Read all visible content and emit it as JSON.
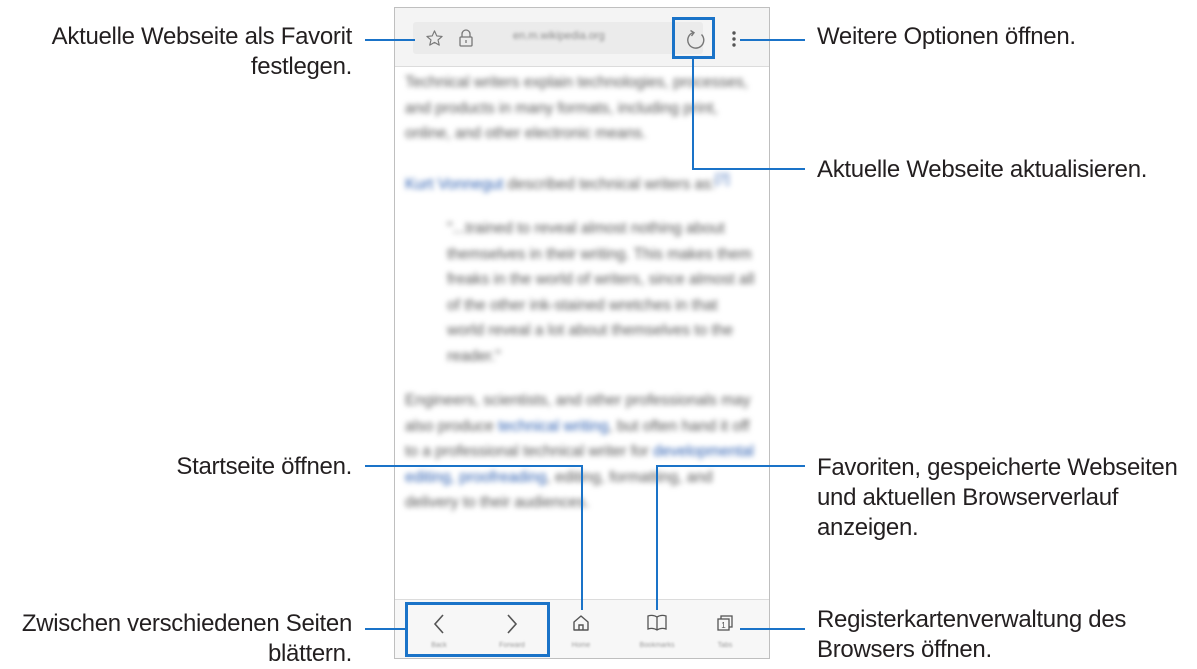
{
  "callouts": {
    "favorite": [
      "Aktuelle Webseite als Favorit",
      "festlegen."
    ],
    "more_options": "Weitere Optionen öffnen.",
    "refresh": "Aktuelle Webseite aktualisieren.",
    "home": "Startseite öffnen.",
    "bookmarks": [
      "Favoriten, gespeicherte Webseiten",
      "und aktuellen Browserverlauf",
      "anzeigen."
    ],
    "navigate": [
      "Zwischen verschiedenen Seiten",
      "blättern."
    ],
    "tabs": [
      "Registerkartenverwaltung des",
      "Browsers öffnen."
    ]
  },
  "browser": {
    "url": "en.m.wikipedia.org",
    "icons": {
      "star": "star-icon",
      "lock": "lock-icon",
      "refresh": "refresh-icon",
      "more": "more-vertical-icon",
      "back": "chevron-left-icon",
      "forward": "chevron-right-icon",
      "home": "home-icon",
      "bookmarks": "book-icon",
      "tabs": "tabs-icon"
    },
    "nav_labels": {
      "back": "Back",
      "forward": "Forward",
      "home": "Home",
      "bookmarks": "Bookmarks",
      "tabs": "Tabs"
    },
    "content": {
      "p1": "Technical writers explain technologies, processes, and products in many formats, including print, online, and other electronic means.",
      "p2_link": "Kurt Vonnegut",
      "p2_rest": " described technical writers as:",
      "p2_ref": "[7]",
      "quote": "\"...trained to reveal almost nothing about themselves in their writing. This makes them freaks in the world of writers, since almost all of the other ink-stained wretches in that world reveal a lot about themselves to the reader.\"",
      "p3_a": "Engineers, scientists, and other professionals may also produce ",
      "p3_link1": "technical writing",
      "p3_b": ", but often hand it off to a professional technical writer for ",
      "p3_link2": "developmental editing, proofreading",
      "p3_c": ", editing, formatting, and delivery to their audiences."
    }
  },
  "colors": {
    "accent": "#1a73c8"
  }
}
